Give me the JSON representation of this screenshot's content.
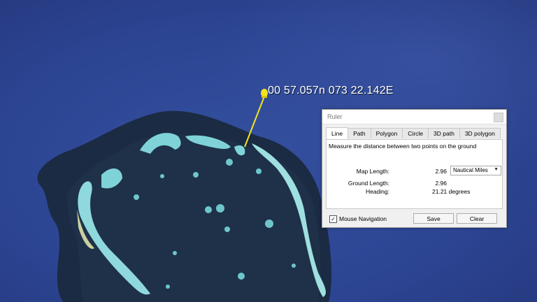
{
  "map": {
    "pin_label": "00 57.057n 073 22.142E"
  },
  "ruler": {
    "title": "Ruler",
    "tabs": [
      "Line",
      "Path",
      "Polygon",
      "Circle",
      "3D path",
      "3D polygon"
    ],
    "description": "Measure the distance between two points on the ground",
    "map_length_label": "Map Length:",
    "map_length_value": "2.96",
    "unit": "Nautical Miles",
    "ground_length_label": "Ground Length:",
    "ground_length_value": "2.96",
    "heading_label": "Heading:",
    "heading_value": "21.21 degrees",
    "mouse_navigation_label": "Mouse Navigation",
    "mouse_navigation_checked": true,
    "save_label": "Save",
    "clear_label": "Clear"
  },
  "colors": {
    "ocean": "#2f4699",
    "atoll_dark": "#1a2a40",
    "reef": "#7fd3d8",
    "pin": "#f2e51c"
  },
  "icons": [
    "pushpin-icon",
    "close-icon",
    "dropdown-arrow-icon",
    "checkbox-check-icon"
  ]
}
